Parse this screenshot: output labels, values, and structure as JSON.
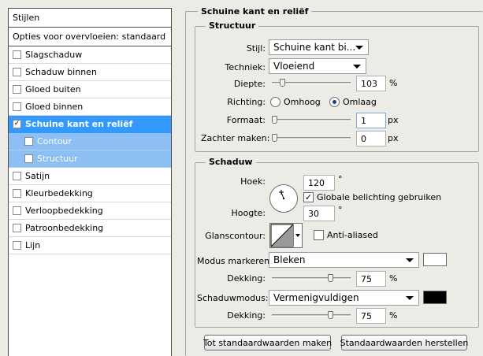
{
  "left_panel": {
    "header": "Stijlen",
    "blend_options": "Opties voor overvloeien: standaard",
    "items": [
      {
        "label": "Slagschaduw",
        "checked": false
      },
      {
        "label": "Schaduw binnen",
        "checked": false
      },
      {
        "label": "Gloed buiten",
        "checked": false
      },
      {
        "label": "Gloed binnen",
        "checked": false
      },
      {
        "label": "Schuine kant en reliëf",
        "checked": true,
        "selected": true
      },
      {
        "label": "Contour",
        "checked": false,
        "sub": true
      },
      {
        "label": "Structuur",
        "checked": false,
        "sub": true
      },
      {
        "label": "Satijn",
        "checked": false
      },
      {
        "label": "Kleurbedekking",
        "checked": false
      },
      {
        "label": "Verloopbedekking",
        "checked": false
      },
      {
        "label": "Patroonbedekking",
        "checked": false
      },
      {
        "label": "Lijn",
        "checked": false
      }
    ],
    "check_glyph": "✓"
  },
  "panel": {
    "title": "Schuine kant en reliëf",
    "structure": {
      "title": "Structuur",
      "style_label": "Stijl:",
      "style_value": "Schuine kant bi...",
      "technique_label": "Techniek:",
      "technique_value": "Vloeiend",
      "depth_label": "Diepte:",
      "depth_value": "103",
      "depth_unit": "%",
      "depth_slider": 0.1,
      "direction_label": "Richting:",
      "direction_up": "Omhoog",
      "direction_down": "Omlaag",
      "direction_selected": "Omlaag",
      "size_label": "Formaat:",
      "size_value": "1",
      "size_unit": "px",
      "size_slider": 0.0,
      "soften_label": "Zachter maken:",
      "soften_value": "0",
      "soften_unit": "px",
      "soften_slider": 0.0
    },
    "shading": {
      "title": "Schaduw",
      "angle_label": "Hoek:",
      "angle_value": "120",
      "angle_unit": "°",
      "global_light_label": "Globale belichting gebruiken",
      "global_light_checked": true,
      "altitude_label": "Hoogte:",
      "altitude_value": "30",
      "altitude_unit": "°",
      "gloss_label": "Glanscontour:",
      "antialias_label": "Anti-aliased",
      "antialias_checked": false,
      "highlight_mode_label": "Modus markeren:",
      "highlight_mode_value": "Bleken",
      "highlight_color": "#ffffff",
      "highlight_opacity_label": "Dekking:",
      "highlight_opacity_value": "75",
      "highlight_opacity_unit": "%",
      "highlight_opacity_slider": 0.75,
      "shadow_mode_label": "Schaduwmodus:",
      "shadow_mode_value": "Vermenigvuldigen",
      "shadow_color": "#000000",
      "shadow_opacity_label": "Dekking:",
      "shadow_opacity_value": "75",
      "shadow_opacity_unit": "%",
      "shadow_opacity_slider": 0.75
    },
    "buttons": {
      "make_default": "Tot standaardwaarden maken",
      "reset_default": "Standaardwaarden herstellen"
    }
  },
  "colors": {
    "selected_row": "#3399ff",
    "sub_row": "#8dbff4"
  }
}
